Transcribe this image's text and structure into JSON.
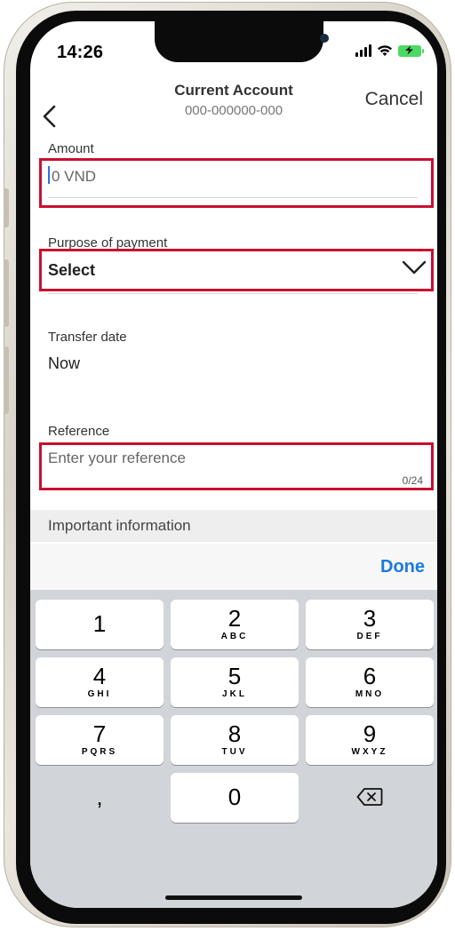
{
  "status_bar": {
    "time": "14:26"
  },
  "nav": {
    "title": "Current Account",
    "account_number": "000-000000-000",
    "cancel_label": "Cancel"
  },
  "form": {
    "amount": {
      "label": "Amount",
      "placeholder": "0 VND"
    },
    "purpose": {
      "label": "Purpose of payment",
      "value": "Select"
    },
    "transfer_date": {
      "label": "Transfer date",
      "value": "Now"
    },
    "reference": {
      "label": "Reference",
      "placeholder": "Enter your reference",
      "counter": "0/24"
    }
  },
  "important_info": {
    "label": "Important information"
  },
  "keyboard": {
    "done_label": "Done",
    "keys": [
      {
        "num": "1",
        "letters": ""
      },
      {
        "num": "2",
        "letters": "ABC"
      },
      {
        "num": "3",
        "letters": "DEF"
      },
      {
        "num": "4",
        "letters": "GHI"
      },
      {
        "num": "5",
        "letters": "JKL"
      },
      {
        "num": "6",
        "letters": "MNO"
      },
      {
        "num": "7",
        "letters": "PQRS"
      },
      {
        "num": "8",
        "letters": "TUV"
      },
      {
        "num": "9",
        "letters": "WXYZ"
      },
      {
        "num": ",",
        "letters": ""
      },
      {
        "num": "0",
        "letters": ""
      }
    ]
  },
  "colors": {
    "highlight": "#c8102e",
    "accent": "#1a7ae0",
    "caret": "#2f6fe4"
  }
}
